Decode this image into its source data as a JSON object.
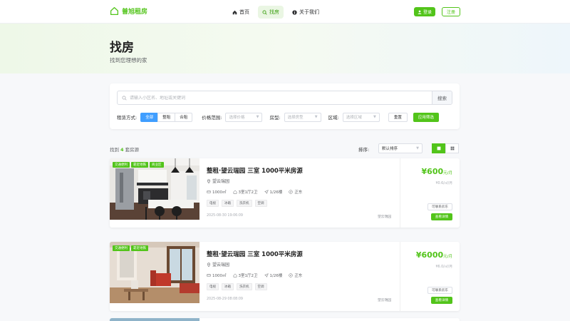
{
  "brand": {
    "name": "普旭租房",
    "accent": "#52c41a"
  },
  "nav": [
    {
      "label": "首页",
      "icon": "home-icon"
    },
    {
      "label": "找房",
      "icon": "search-icon",
      "active": true
    },
    {
      "label": "关于我们",
      "icon": "info-icon"
    }
  ],
  "auth": {
    "login": "登录",
    "register": "注册"
  },
  "hero": {
    "title": "找房",
    "subtitle": "找到您理想的家"
  },
  "search": {
    "placeholder": "请输入小区名、地址或关键词",
    "button": "搜索"
  },
  "filters": {
    "rent_type_label": "租赁方式:",
    "rent_types": [
      "全部",
      "整租",
      "合租"
    ],
    "rent_type_active": "全部",
    "price_label": "价格范围:",
    "price_placeholder": "选择价格",
    "layout_label": "房型:",
    "layout_placeholder": "选择房型",
    "area_label": "区域:",
    "area_placeholder": "选择区域",
    "reset": "重置",
    "apply": "应用筛选"
  },
  "results": {
    "prefix": "找到",
    "count": "4",
    "suffix": "套房源"
  },
  "sort": {
    "label": "排序:",
    "value": "默认排序"
  },
  "listings": [
    {
      "tags": [
        "交通便利",
        "靠近地铁",
        "商业区"
      ],
      "title": "整租·望云瑞园 三室 1000平米房源",
      "community": "望云瑞园",
      "area": "1000㎡",
      "layout": "3室1厅2卫",
      "floor": "1/26楼",
      "orientation": "正东",
      "amenities": [
        "电视",
        "冰箱",
        "洗衣机",
        "空调"
      ],
      "date": "2025-08-30 19:06:09",
      "district": "望云瑞园",
      "price": "¥600",
      "price_unit": "元/月",
      "unit_price": "¥0.6/㎡/月",
      "contact": "可联系房东",
      "detail": "查看详情"
    },
    {
      "tags": [
        "交通便利",
        "靠近地铁"
      ],
      "title": "整租·望云瑞园 三室 1000平米房源",
      "community": "望云瑞园",
      "area": "1000㎡",
      "layout": "3室1厅2卫",
      "floor": "1/26楼",
      "orientation": "正东",
      "amenities": [
        "电视",
        "冰箱",
        "洗衣机",
        "空调"
      ],
      "date": "2025-08-29 08:08:09",
      "district": "望云瑞园",
      "price": "¥6000",
      "price_unit": "元/月",
      "unit_price": "¥6.0/㎡/月",
      "contact": "可联系房东",
      "detail": "查看详情"
    }
  ]
}
